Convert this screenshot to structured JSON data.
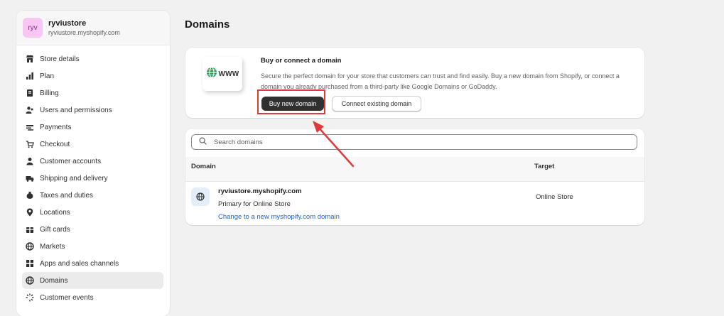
{
  "store": {
    "avatar": "ryv",
    "name": "ryviustore",
    "url": "ryviustore.myshopify.com"
  },
  "sidebar": {
    "items": [
      {
        "label": "Store details",
        "icon": "store-icon"
      },
      {
        "label": "Plan",
        "icon": "plan-icon"
      },
      {
        "label": "Billing",
        "icon": "billing-icon"
      },
      {
        "label": "Users and permissions",
        "icon": "users-icon"
      },
      {
        "label": "Payments",
        "icon": "payments-icon"
      },
      {
        "label": "Checkout",
        "icon": "cart-icon"
      },
      {
        "label": "Customer accounts",
        "icon": "person-icon"
      },
      {
        "label": "Shipping and delivery",
        "icon": "truck-icon"
      },
      {
        "label": "Taxes and duties",
        "icon": "tax-icon"
      },
      {
        "label": "Locations",
        "icon": "location-pin-icon"
      },
      {
        "label": "Gift cards",
        "icon": "gift-card-icon"
      },
      {
        "label": "Markets",
        "icon": "globe-icon"
      },
      {
        "label": "Apps and sales channels",
        "icon": "apps-icon"
      },
      {
        "label": "Domains",
        "icon": "globe-icon",
        "active": true
      },
      {
        "label": "Customer events",
        "icon": "events-icon"
      }
    ]
  },
  "page": {
    "title": "Domains"
  },
  "promo": {
    "image_text": "WWW",
    "title": "Buy or connect a domain",
    "description": "Secure the perfect domain for your store that customers can trust and find easily. Buy a new domain from Shopify, or connect a domain you already purchased from a third-party like Google Domains or GoDaddy.",
    "buy_label": "Buy new domain",
    "connect_label": "Connect existing domain"
  },
  "domains": {
    "search_placeholder": "Search domains",
    "columns": {
      "domain": "Domain",
      "target": "Target"
    },
    "rows": [
      {
        "name": "ryviustore.myshopify.com",
        "primary": "Primary for Online Store",
        "link": "Change to a new myshopify.com domain",
        "target": "Online Store"
      }
    ]
  },
  "colors": {
    "annotation": "#e03a3a",
    "link": "#2463d4",
    "primary_button": "#303030"
  }
}
